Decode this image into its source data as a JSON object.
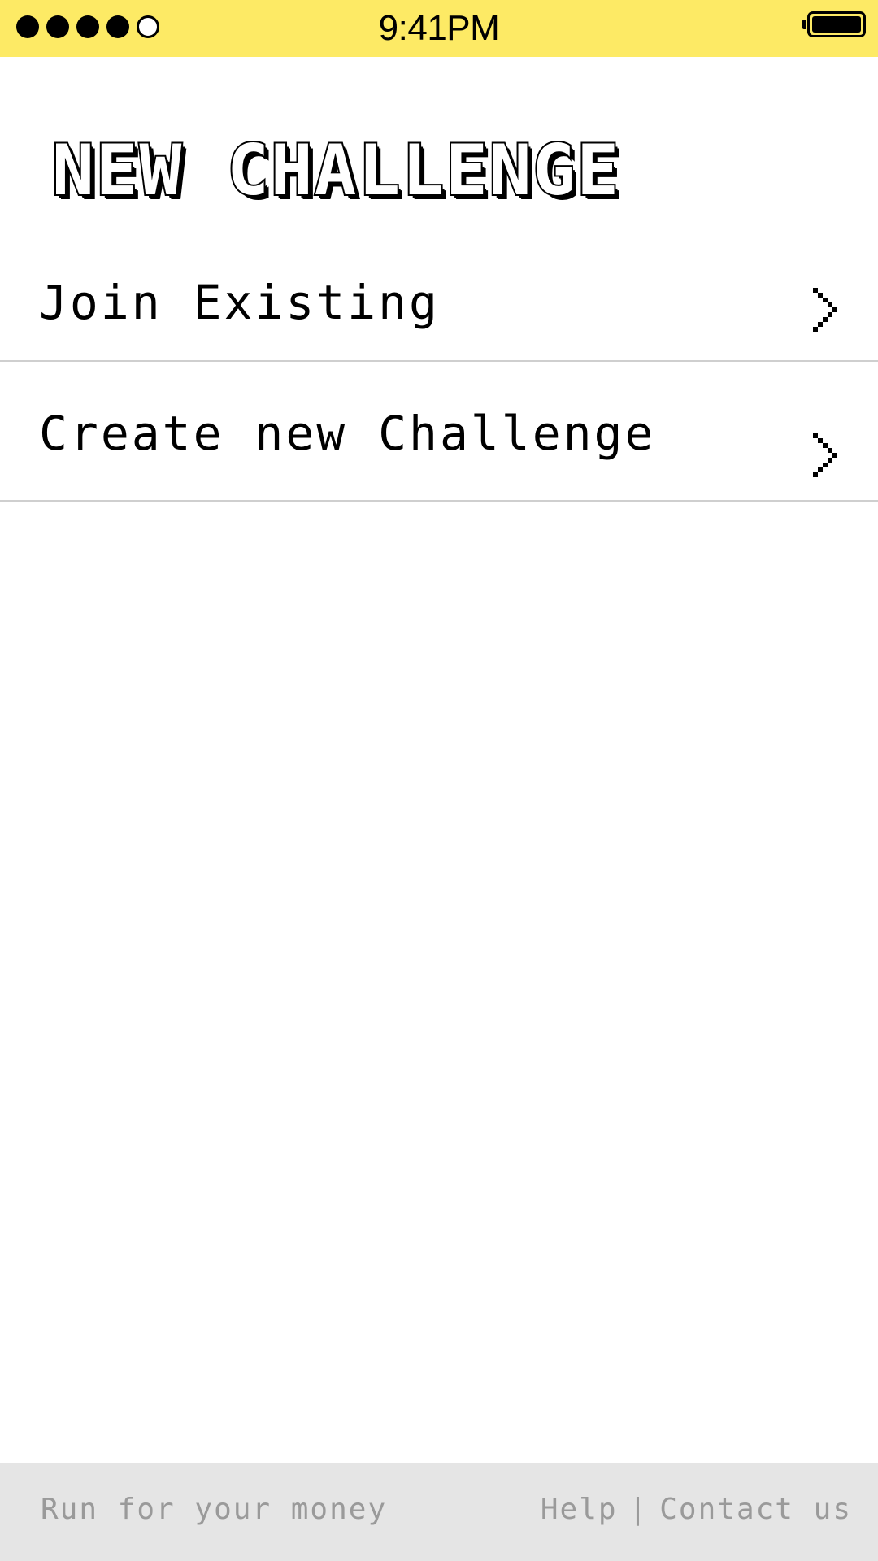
{
  "status_bar": {
    "signal_bars_filled": 4,
    "signal_bars_total": 5,
    "time": "9:41PM",
    "battery_level": 1.0,
    "background_color": "#fdea65"
  },
  "page": {
    "title": "NEW CHALLENGE"
  },
  "menu": {
    "items": [
      {
        "label": "Join Existing",
        "icon": "chevron-right-icon"
      },
      {
        "label": "Create new Challenge",
        "icon": "chevron-right-icon"
      }
    ]
  },
  "footer": {
    "tagline": "Run for your money",
    "help": "Help",
    "separator": "|",
    "contact": "Contact us",
    "background_color": "#e5e5e5",
    "text_color": "#9a9a9a"
  }
}
